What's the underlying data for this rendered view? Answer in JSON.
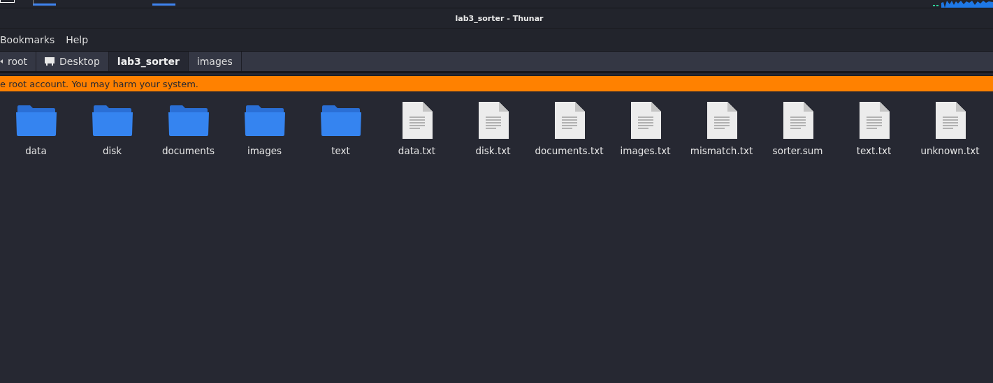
{
  "window": {
    "title": "lab3_sorter - Thunar"
  },
  "menu": [
    "Bookmarks",
    "Help"
  ],
  "path_bar": [
    {
      "label": "root",
      "kind": "partial",
      "selected": false
    },
    {
      "label": "Desktop",
      "kind": "desktop",
      "selected": false
    },
    {
      "label": "lab3_sorter",
      "kind": "plain",
      "selected": true
    },
    {
      "label": "images",
      "kind": "plain",
      "selected": false
    }
  ],
  "warning": "e root account. You may harm your system.",
  "files": [
    {
      "name": "data",
      "kind": "folder"
    },
    {
      "name": "disk",
      "kind": "folder"
    },
    {
      "name": "documents",
      "kind": "folder"
    },
    {
      "name": "images",
      "kind": "folder"
    },
    {
      "name": "text",
      "kind": "folder"
    },
    {
      "name": "data.txt",
      "kind": "file"
    },
    {
      "name": "disk.txt",
      "kind": "file"
    },
    {
      "name": "documents.txt",
      "kind": "file"
    },
    {
      "name": "images.txt",
      "kind": "file"
    },
    {
      "name": "mismatch.txt",
      "kind": "file"
    },
    {
      "name": "sorter.sum",
      "kind": "file"
    },
    {
      "name": "text.txt",
      "kind": "file"
    },
    {
      "name": "unknown.txt",
      "kind": "file"
    }
  ]
}
